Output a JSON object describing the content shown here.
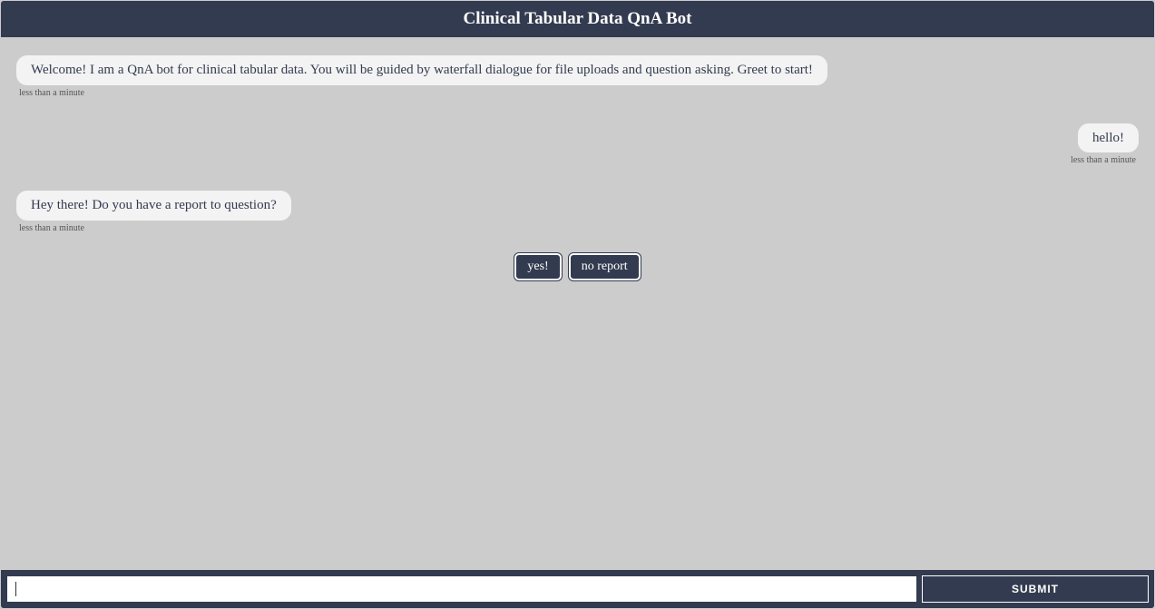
{
  "header": {
    "title": "Clinical Tabular Data QnA Bot"
  },
  "messages": [
    {
      "role": "bot",
      "text": "Welcome! I am a QnA bot for clinical tabular data. You will be guided by waterfall dialogue for file uploads and question asking. Greet to start!",
      "timestamp": "less than a minute"
    },
    {
      "role": "user",
      "text": "hello!",
      "timestamp": "less than a minute"
    },
    {
      "role": "bot",
      "text": "Hey there! Do you have a report to question?",
      "timestamp": "less than a minute"
    }
  ],
  "choices": {
    "items": [
      {
        "label": "yes!"
      },
      {
        "label": "no report"
      }
    ]
  },
  "footer": {
    "input_value": "",
    "input_placeholder": "",
    "submit_label": "SUBMIT"
  }
}
